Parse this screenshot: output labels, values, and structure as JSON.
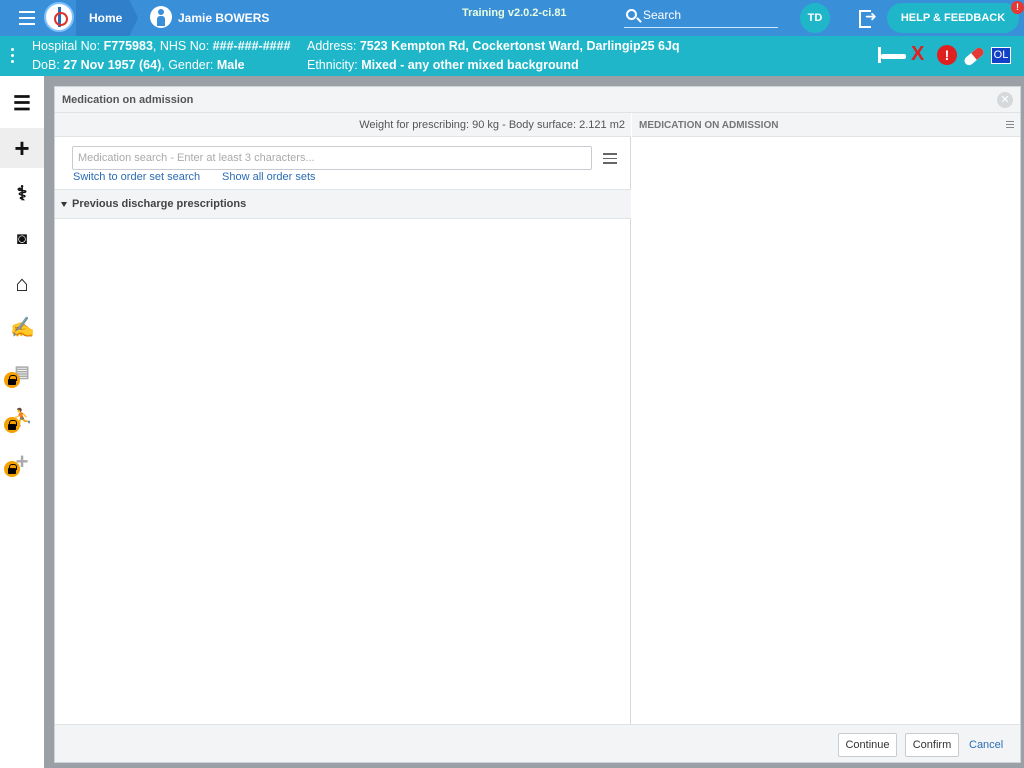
{
  "topbar": {
    "home_label": "Home",
    "patient_name": "Jamie BOWERS",
    "version": "Training v2.0.2-ci.81",
    "search_label": "Search",
    "user_initials": "TD",
    "help_label": "HELP & FEEDBACK",
    "help_badge": "!"
  },
  "banner": {
    "hospital_no_label": "Hospital No: ",
    "hospital_no": "F775983",
    "nhs_no_label": ", NHS No: ",
    "nhs_no": "###-###-####",
    "dob_label": "DoB: ",
    "dob": "27 Nov 1957 (64)",
    "gender_label": ", Gender: ",
    "gender": "Male",
    "address_label": "Address: ",
    "address": "7523 Kempton Rd, Cockertonst Ward, Darlingip25 6Jq",
    "ethnicity_label": "Ethnicity: ",
    "ethnicity": "Mixed - any other mixed background",
    "alert_x": "X",
    "alert_warning": "!",
    "alert_ol": "OL"
  },
  "sidebar": {
    "items": [
      {
        "icon": "list-icon",
        "glyph": "☰",
        "locked": false
      },
      {
        "icon": "plus-icon",
        "glyph": "+",
        "locked": false
      },
      {
        "icon": "stethoscope-icon",
        "glyph": "⚕",
        "locked": false
      },
      {
        "icon": "camera-icon",
        "glyph": "📷",
        "locked": false
      },
      {
        "icon": "home-icon",
        "glyph": "⌂",
        "locked": false
      },
      {
        "icon": "signature-icon",
        "glyph": "✍",
        "locked": false
      },
      {
        "icon": "clipboard-icon",
        "glyph": "📋",
        "locked": true
      },
      {
        "icon": "walking-icon",
        "glyph": "🚶",
        "locked": true
      },
      {
        "icon": "add-icon",
        "glyph": "+",
        "locked": true
      }
    ]
  },
  "modal": {
    "title": "Medication on admission",
    "weight_text": "Weight for prescribing: 90 kg - Body surface: 2.121 m2",
    "search_placeholder": "Medication search - Enter at least 3 characters...",
    "switch_link": "Switch to order set search",
    "show_link": "Show all order sets",
    "section_title": "Previous discharge prescriptions",
    "right_title": "MEDICATION ON ADMISSION",
    "footer": {
      "continue": "Continue",
      "confirm": "Confirm",
      "cancel": "Cancel"
    }
  },
  "colors": {
    "topbar": "#3a8fd9",
    "banner": "#1fb6c9",
    "link": "#2a6db5",
    "alert_red": "#e01f1f",
    "lock": "#f5a000"
  }
}
